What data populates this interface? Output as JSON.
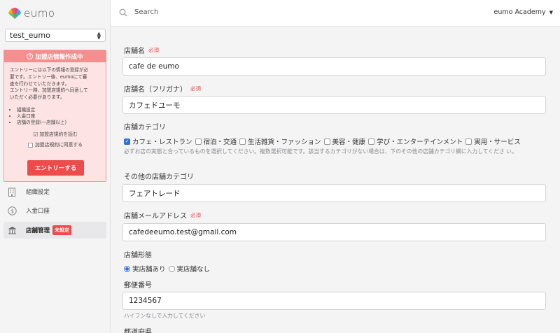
{
  "app": {
    "logo_text": "eumo"
  },
  "sidebar": {
    "account_select": "test_eumo",
    "notice": {
      "title": "加盟店情報作成中",
      "body_lines": [
        "エントリーには以下の情報の登録が必",
        "要です。エントリー後、eumoにて審",
        "査を行わせていただきます。",
        "エントリー時、加盟店規約へ同意して",
        "いただく必要があります。"
      ],
      "requirements": [
        "組織設定",
        "入金口座",
        "店舗の登録(一店舗以上)"
      ],
      "read_terms": "加盟店規約を読む",
      "agree_terms": "加盟店規約に同意する",
      "entry_button": "エントリーする"
    },
    "nav": [
      {
        "label": "組織設定",
        "icon": "building-icon"
      },
      {
        "label": "入金口座",
        "icon": "dollar-circle-icon"
      },
      {
        "label": "店舗管理",
        "icon": "store-icon",
        "badge": "未設定",
        "active": true
      }
    ]
  },
  "topbar": {
    "search_placeholder": "Search",
    "user_menu": "eumo Academy"
  },
  "form": {
    "store_name": {
      "label": "店舗名",
      "required": "必須",
      "value": "cafe de eumo"
    },
    "store_name_kana": {
      "label": "店舗名（フリガナ）",
      "required": "必須",
      "value": "カフェドユーモ"
    },
    "category": {
      "label": "店舗カテゴリ",
      "options": [
        {
          "label": "カフェ・レストラン",
          "checked": true
        },
        {
          "label": "宿泊・交通",
          "checked": false
        },
        {
          "label": "生活雑貨・ファッション",
          "checked": false
        },
        {
          "label": "美容・健康",
          "checked": false
        },
        {
          "label": "学び・エンターテインメント",
          "checked": false
        },
        {
          "label": "実用・サービス",
          "checked": false
        }
      ],
      "hint": "必ずお店の実態と合っているものを選択してください。複数選択可能です。該当するカテゴリがない場合は、下のその他の店舗カテゴリ欄に入力してくださ い。"
    },
    "other_category": {
      "label": "その他の店舗カテゴリ",
      "value": "フェアトレード"
    },
    "email": {
      "label": "店舗メールアドレス",
      "required": "必須",
      "value": "cafedeeumo.test@gmail.com"
    },
    "store_type": {
      "label": "店舗形態",
      "options": [
        {
          "label": "実店舗あり",
          "selected": true
        },
        {
          "label": "実店舗なし",
          "selected": false
        }
      ]
    },
    "postal_code": {
      "label": "郵便番号",
      "value": "1234567",
      "hint": "ハイフンなしで入力してください"
    },
    "prefecture": {
      "label": "都道府県"
    }
  },
  "colors": {
    "accent": "#ee4b4b",
    "primary": "#2f6fe0",
    "notice_bg": "#fde3e3"
  }
}
